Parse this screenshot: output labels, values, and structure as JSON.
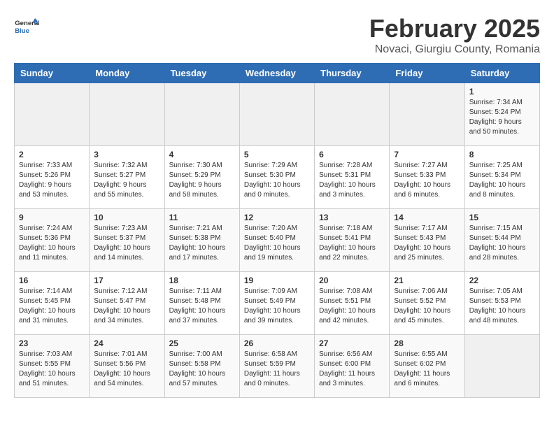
{
  "header": {
    "logo_general": "General",
    "logo_blue": "Blue",
    "month_year": "February 2025",
    "location": "Novaci, Giurgiu County, Romania"
  },
  "weekdays": [
    "Sunday",
    "Monday",
    "Tuesday",
    "Wednesday",
    "Thursday",
    "Friday",
    "Saturday"
  ],
  "weeks": [
    [
      {
        "day": "",
        "info": ""
      },
      {
        "day": "",
        "info": ""
      },
      {
        "day": "",
        "info": ""
      },
      {
        "day": "",
        "info": ""
      },
      {
        "day": "",
        "info": ""
      },
      {
        "day": "",
        "info": ""
      },
      {
        "day": "1",
        "info": "Sunrise: 7:34 AM\nSunset: 5:24 PM\nDaylight: 9 hours and 50 minutes."
      }
    ],
    [
      {
        "day": "2",
        "info": "Sunrise: 7:33 AM\nSunset: 5:26 PM\nDaylight: 9 hours and 53 minutes."
      },
      {
        "day": "3",
        "info": "Sunrise: 7:32 AM\nSunset: 5:27 PM\nDaylight: 9 hours and 55 minutes."
      },
      {
        "day": "4",
        "info": "Sunrise: 7:30 AM\nSunset: 5:29 PM\nDaylight: 9 hours and 58 minutes."
      },
      {
        "day": "5",
        "info": "Sunrise: 7:29 AM\nSunset: 5:30 PM\nDaylight: 10 hours and 0 minutes."
      },
      {
        "day": "6",
        "info": "Sunrise: 7:28 AM\nSunset: 5:31 PM\nDaylight: 10 hours and 3 minutes."
      },
      {
        "day": "7",
        "info": "Sunrise: 7:27 AM\nSunset: 5:33 PM\nDaylight: 10 hours and 6 minutes."
      },
      {
        "day": "8",
        "info": "Sunrise: 7:25 AM\nSunset: 5:34 PM\nDaylight: 10 hours and 8 minutes."
      }
    ],
    [
      {
        "day": "9",
        "info": "Sunrise: 7:24 AM\nSunset: 5:36 PM\nDaylight: 10 hours and 11 minutes."
      },
      {
        "day": "10",
        "info": "Sunrise: 7:23 AM\nSunset: 5:37 PM\nDaylight: 10 hours and 14 minutes."
      },
      {
        "day": "11",
        "info": "Sunrise: 7:21 AM\nSunset: 5:38 PM\nDaylight: 10 hours and 17 minutes."
      },
      {
        "day": "12",
        "info": "Sunrise: 7:20 AM\nSunset: 5:40 PM\nDaylight: 10 hours and 19 minutes."
      },
      {
        "day": "13",
        "info": "Sunrise: 7:18 AM\nSunset: 5:41 PM\nDaylight: 10 hours and 22 minutes."
      },
      {
        "day": "14",
        "info": "Sunrise: 7:17 AM\nSunset: 5:43 PM\nDaylight: 10 hours and 25 minutes."
      },
      {
        "day": "15",
        "info": "Sunrise: 7:15 AM\nSunset: 5:44 PM\nDaylight: 10 hours and 28 minutes."
      }
    ],
    [
      {
        "day": "16",
        "info": "Sunrise: 7:14 AM\nSunset: 5:45 PM\nDaylight: 10 hours and 31 minutes."
      },
      {
        "day": "17",
        "info": "Sunrise: 7:12 AM\nSunset: 5:47 PM\nDaylight: 10 hours and 34 minutes."
      },
      {
        "day": "18",
        "info": "Sunrise: 7:11 AM\nSunset: 5:48 PM\nDaylight: 10 hours and 37 minutes."
      },
      {
        "day": "19",
        "info": "Sunrise: 7:09 AM\nSunset: 5:49 PM\nDaylight: 10 hours and 39 minutes."
      },
      {
        "day": "20",
        "info": "Sunrise: 7:08 AM\nSunset: 5:51 PM\nDaylight: 10 hours and 42 minutes."
      },
      {
        "day": "21",
        "info": "Sunrise: 7:06 AM\nSunset: 5:52 PM\nDaylight: 10 hours and 45 minutes."
      },
      {
        "day": "22",
        "info": "Sunrise: 7:05 AM\nSunset: 5:53 PM\nDaylight: 10 hours and 48 minutes."
      }
    ],
    [
      {
        "day": "23",
        "info": "Sunrise: 7:03 AM\nSunset: 5:55 PM\nDaylight: 10 hours and 51 minutes."
      },
      {
        "day": "24",
        "info": "Sunrise: 7:01 AM\nSunset: 5:56 PM\nDaylight: 10 hours and 54 minutes."
      },
      {
        "day": "25",
        "info": "Sunrise: 7:00 AM\nSunset: 5:58 PM\nDaylight: 10 hours and 57 minutes."
      },
      {
        "day": "26",
        "info": "Sunrise: 6:58 AM\nSunset: 5:59 PM\nDaylight: 11 hours and 0 minutes."
      },
      {
        "day": "27",
        "info": "Sunrise: 6:56 AM\nSunset: 6:00 PM\nDaylight: 11 hours and 3 minutes."
      },
      {
        "day": "28",
        "info": "Sunrise: 6:55 AM\nSunset: 6:02 PM\nDaylight: 11 hours and 6 minutes."
      },
      {
        "day": "",
        "info": ""
      }
    ]
  ]
}
